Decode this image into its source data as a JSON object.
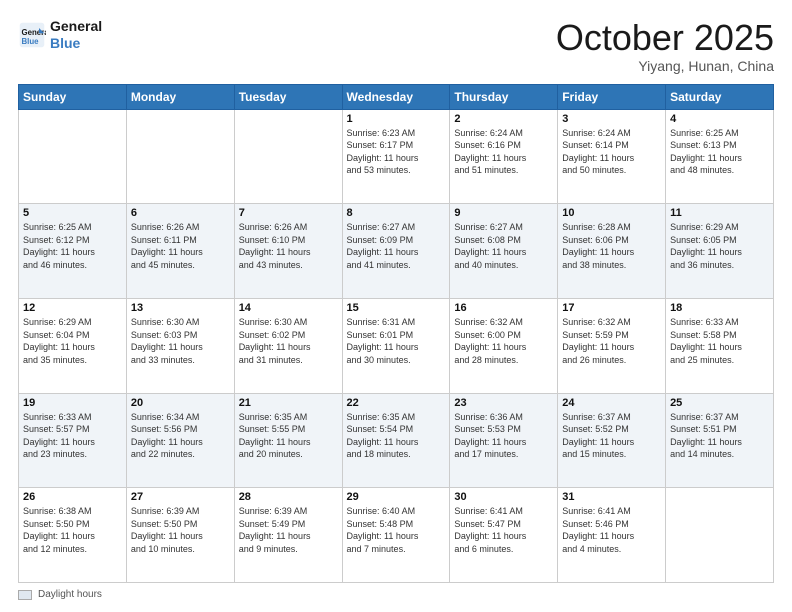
{
  "header": {
    "logo_line1": "General",
    "logo_line2": "Blue",
    "title": "October 2025",
    "subtitle": "Yiyang, Hunan, China"
  },
  "footer": {
    "daylight_label": "Daylight hours"
  },
  "days_of_week": [
    "Sunday",
    "Monday",
    "Tuesday",
    "Wednesday",
    "Thursday",
    "Friday",
    "Saturday"
  ],
  "weeks": [
    [
      {
        "day": "",
        "info": ""
      },
      {
        "day": "",
        "info": ""
      },
      {
        "day": "",
        "info": ""
      },
      {
        "day": "1",
        "info": "Sunrise: 6:23 AM\nSunset: 6:17 PM\nDaylight: 11 hours\nand 53 minutes."
      },
      {
        "day": "2",
        "info": "Sunrise: 6:24 AM\nSunset: 6:16 PM\nDaylight: 11 hours\nand 51 minutes."
      },
      {
        "day": "3",
        "info": "Sunrise: 6:24 AM\nSunset: 6:14 PM\nDaylight: 11 hours\nand 50 minutes."
      },
      {
        "day": "4",
        "info": "Sunrise: 6:25 AM\nSunset: 6:13 PM\nDaylight: 11 hours\nand 48 minutes."
      }
    ],
    [
      {
        "day": "5",
        "info": "Sunrise: 6:25 AM\nSunset: 6:12 PM\nDaylight: 11 hours\nand 46 minutes."
      },
      {
        "day": "6",
        "info": "Sunrise: 6:26 AM\nSunset: 6:11 PM\nDaylight: 11 hours\nand 45 minutes."
      },
      {
        "day": "7",
        "info": "Sunrise: 6:26 AM\nSunset: 6:10 PM\nDaylight: 11 hours\nand 43 minutes."
      },
      {
        "day": "8",
        "info": "Sunrise: 6:27 AM\nSunset: 6:09 PM\nDaylight: 11 hours\nand 41 minutes."
      },
      {
        "day": "9",
        "info": "Sunrise: 6:27 AM\nSunset: 6:08 PM\nDaylight: 11 hours\nand 40 minutes."
      },
      {
        "day": "10",
        "info": "Sunrise: 6:28 AM\nSunset: 6:06 PM\nDaylight: 11 hours\nand 38 minutes."
      },
      {
        "day": "11",
        "info": "Sunrise: 6:29 AM\nSunset: 6:05 PM\nDaylight: 11 hours\nand 36 minutes."
      }
    ],
    [
      {
        "day": "12",
        "info": "Sunrise: 6:29 AM\nSunset: 6:04 PM\nDaylight: 11 hours\nand 35 minutes."
      },
      {
        "day": "13",
        "info": "Sunrise: 6:30 AM\nSunset: 6:03 PM\nDaylight: 11 hours\nand 33 minutes."
      },
      {
        "day": "14",
        "info": "Sunrise: 6:30 AM\nSunset: 6:02 PM\nDaylight: 11 hours\nand 31 minutes."
      },
      {
        "day": "15",
        "info": "Sunrise: 6:31 AM\nSunset: 6:01 PM\nDaylight: 11 hours\nand 30 minutes."
      },
      {
        "day": "16",
        "info": "Sunrise: 6:32 AM\nSunset: 6:00 PM\nDaylight: 11 hours\nand 28 minutes."
      },
      {
        "day": "17",
        "info": "Sunrise: 6:32 AM\nSunset: 5:59 PM\nDaylight: 11 hours\nand 26 minutes."
      },
      {
        "day": "18",
        "info": "Sunrise: 6:33 AM\nSunset: 5:58 PM\nDaylight: 11 hours\nand 25 minutes."
      }
    ],
    [
      {
        "day": "19",
        "info": "Sunrise: 6:33 AM\nSunset: 5:57 PM\nDaylight: 11 hours\nand 23 minutes."
      },
      {
        "day": "20",
        "info": "Sunrise: 6:34 AM\nSunset: 5:56 PM\nDaylight: 11 hours\nand 22 minutes."
      },
      {
        "day": "21",
        "info": "Sunrise: 6:35 AM\nSunset: 5:55 PM\nDaylight: 11 hours\nand 20 minutes."
      },
      {
        "day": "22",
        "info": "Sunrise: 6:35 AM\nSunset: 5:54 PM\nDaylight: 11 hours\nand 18 minutes."
      },
      {
        "day": "23",
        "info": "Sunrise: 6:36 AM\nSunset: 5:53 PM\nDaylight: 11 hours\nand 17 minutes."
      },
      {
        "day": "24",
        "info": "Sunrise: 6:37 AM\nSunset: 5:52 PM\nDaylight: 11 hours\nand 15 minutes."
      },
      {
        "day": "25",
        "info": "Sunrise: 6:37 AM\nSunset: 5:51 PM\nDaylight: 11 hours\nand 14 minutes."
      }
    ],
    [
      {
        "day": "26",
        "info": "Sunrise: 6:38 AM\nSunset: 5:50 PM\nDaylight: 11 hours\nand 12 minutes."
      },
      {
        "day": "27",
        "info": "Sunrise: 6:39 AM\nSunset: 5:50 PM\nDaylight: 11 hours\nand 10 minutes."
      },
      {
        "day": "28",
        "info": "Sunrise: 6:39 AM\nSunset: 5:49 PM\nDaylight: 11 hours\nand 9 minutes."
      },
      {
        "day": "29",
        "info": "Sunrise: 6:40 AM\nSunset: 5:48 PM\nDaylight: 11 hours\nand 7 minutes."
      },
      {
        "day": "30",
        "info": "Sunrise: 6:41 AM\nSunset: 5:47 PM\nDaylight: 11 hours\nand 6 minutes."
      },
      {
        "day": "31",
        "info": "Sunrise: 6:41 AM\nSunset: 5:46 PM\nDaylight: 11 hours\nand 4 minutes."
      },
      {
        "day": "",
        "info": ""
      }
    ]
  ]
}
